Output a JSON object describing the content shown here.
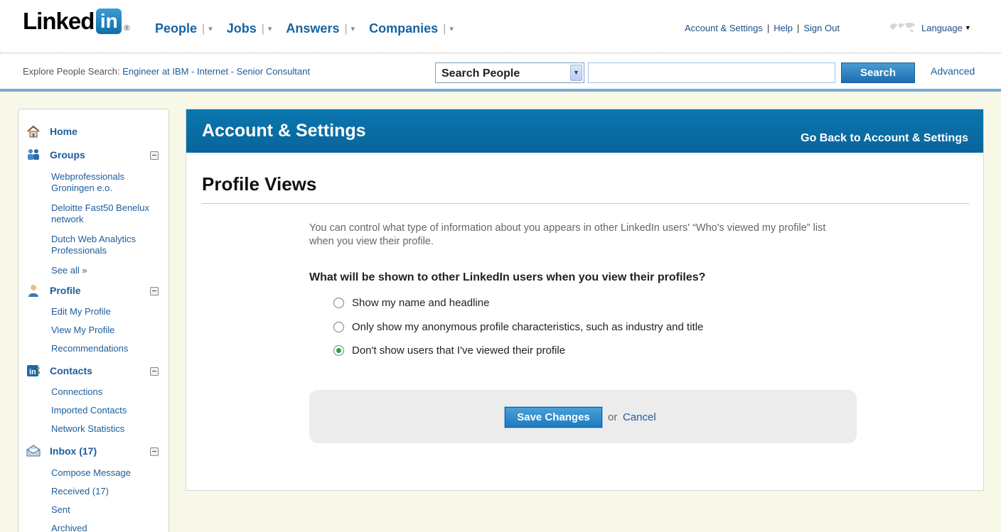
{
  "logo": {
    "word": "Linked",
    "in": "in",
    "reg": "®"
  },
  "nav": {
    "items": [
      {
        "label": "People"
      },
      {
        "label": "Jobs"
      },
      {
        "label": "Answers"
      },
      {
        "label": "Companies"
      }
    ],
    "separator": "|",
    "caret": "▾"
  },
  "util": {
    "account_settings": "Account & Settings",
    "help": "Help",
    "sign_out": "Sign Out",
    "separator": "|",
    "language": "Language"
  },
  "search": {
    "explore_prefix": "Explore People Search:",
    "explore_links": "Engineer at IBM - Internet - Senior Consultant",
    "select_value": "Search People",
    "input_value": "",
    "button": "Search",
    "advanced": "Advanced"
  },
  "sidebar": {
    "home": "Home",
    "groups": {
      "title": "Groups",
      "items": [
        "Webprofessionals Groningen e.o.",
        "Deloitte Fast50 Benelux network",
        "Dutch Web Analytics Professionals",
        "See all »"
      ]
    },
    "profile": {
      "title": "Profile",
      "items": [
        "Edit My Profile",
        "View My Profile",
        "Recommendations"
      ]
    },
    "contacts": {
      "title": "Contacts",
      "items": [
        "Connections",
        "Imported Contacts",
        "Network Statistics"
      ]
    },
    "inbox": {
      "title": "Inbox (17)",
      "items": [
        "Compose Message",
        "Received (17)",
        "Sent",
        "Archived"
      ]
    }
  },
  "panel": {
    "title": "Account & Settings",
    "back_link": "Go Back to Account & Settings",
    "section_title": "Profile Views",
    "intro": "You can control what type of information about you appears in other LinkedIn users' “Who's viewed my profile” list when you view their profile.",
    "question": "What will be shown to other LinkedIn users when you view their profiles?",
    "options": [
      {
        "label": "Show my name and headline",
        "checked": false
      },
      {
        "label": "Only show my anonymous profile characteristics, such as industry and title",
        "checked": false
      },
      {
        "label": "Don't show users that I've viewed their profile",
        "checked": true
      }
    ],
    "save": "Save Changes",
    "or": "or",
    "cancel": "Cancel"
  },
  "colors": {
    "brand_blue": "#0b76af",
    "link_blue": "#1d5d9a",
    "radio_checked": "#29a33d"
  }
}
